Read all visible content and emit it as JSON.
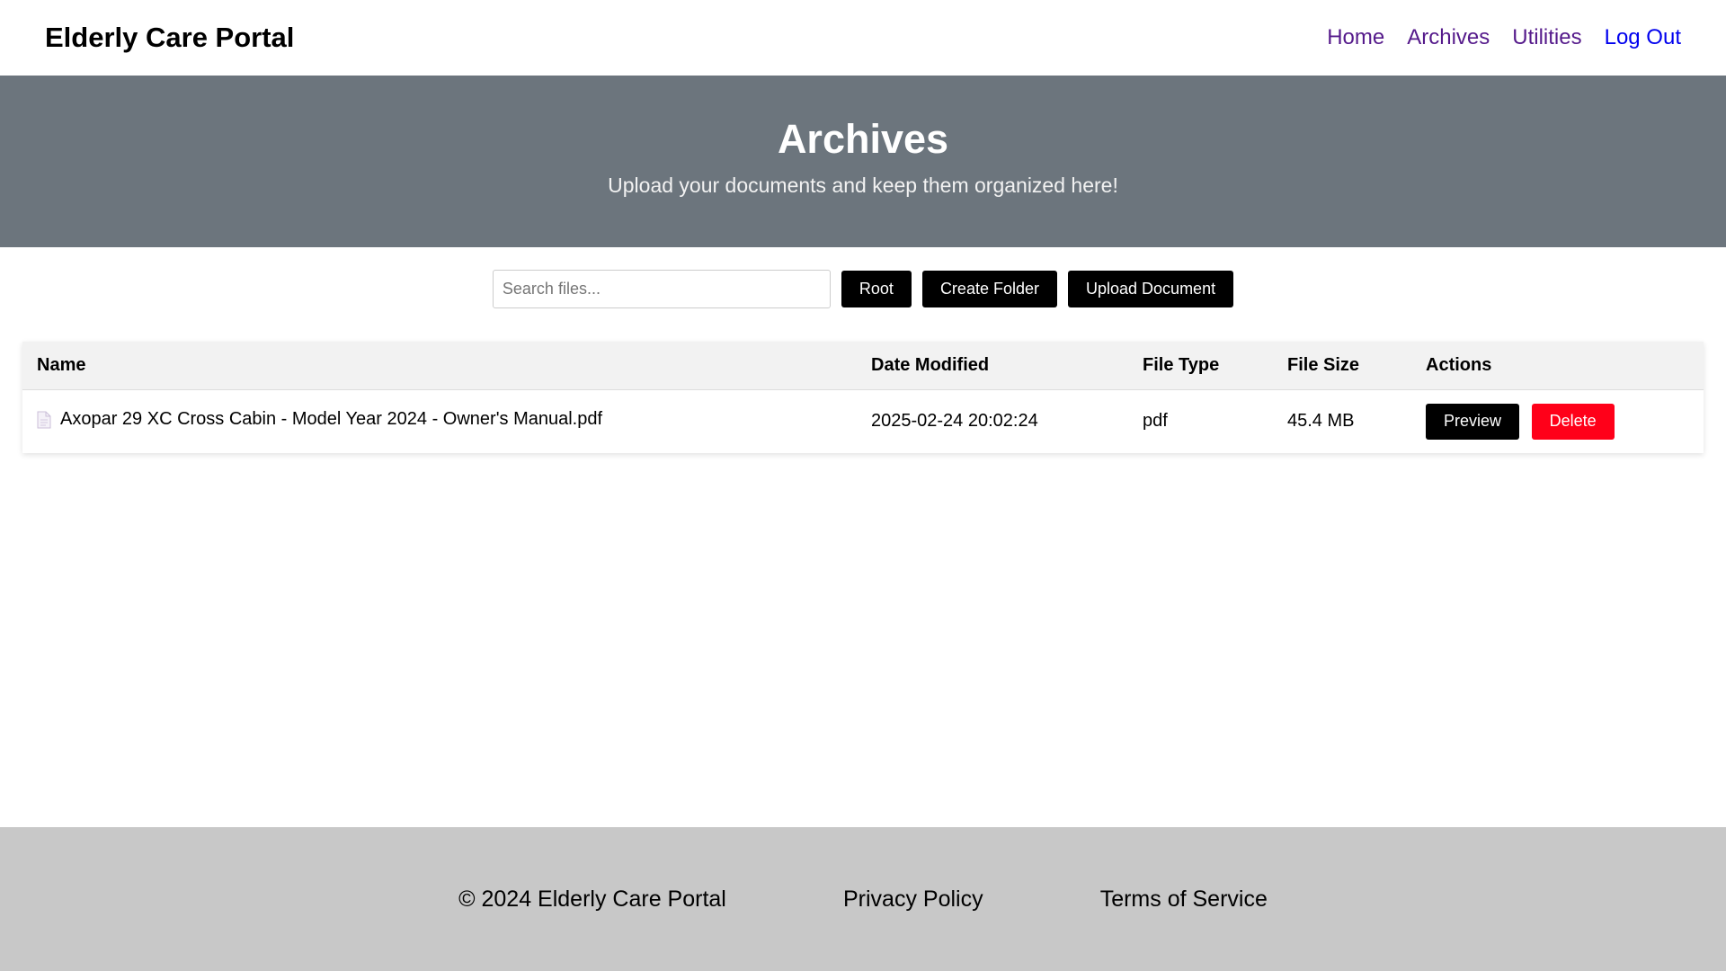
{
  "header": {
    "brand": "Elderly Care Portal",
    "nav": [
      {
        "label": "Home"
      },
      {
        "label": "Archives"
      },
      {
        "label": "Utilities"
      },
      {
        "label": "Log Out"
      }
    ]
  },
  "hero": {
    "title": "Archives",
    "subtitle": "Upload your documents and keep them organized here!"
  },
  "toolbar": {
    "search_placeholder": "Search files...",
    "search_value": "",
    "root_label": "Root",
    "create_folder_label": "Create Folder",
    "upload_label": "Upload Document"
  },
  "table": {
    "columns": [
      "Name",
      "Date Modified",
      "File Type",
      "File Size",
      "Actions"
    ],
    "rows": [
      {
        "icon": "document-icon",
        "name": "Axopar 29 XC Cross Cabin - Model Year 2024 - Owner's Manual.pdf",
        "date_modified": "2025-02-24 20:02:24",
        "file_type": "pdf",
        "file_size": "45.4 MB",
        "preview_label": "Preview",
        "delete_label": "Delete"
      }
    ]
  },
  "footer": {
    "copyright": "© 2024 Elderly Care Portal",
    "privacy": "Privacy Policy",
    "terms": "Terms of Service"
  },
  "colors": {
    "hero_bg": "#6c757d",
    "footer_bg": "#c8c8c8",
    "delete_button": "#ff0019",
    "primary_button": "#000000",
    "nav_visited": "#551a8b",
    "nav_link": "#0000ee"
  }
}
